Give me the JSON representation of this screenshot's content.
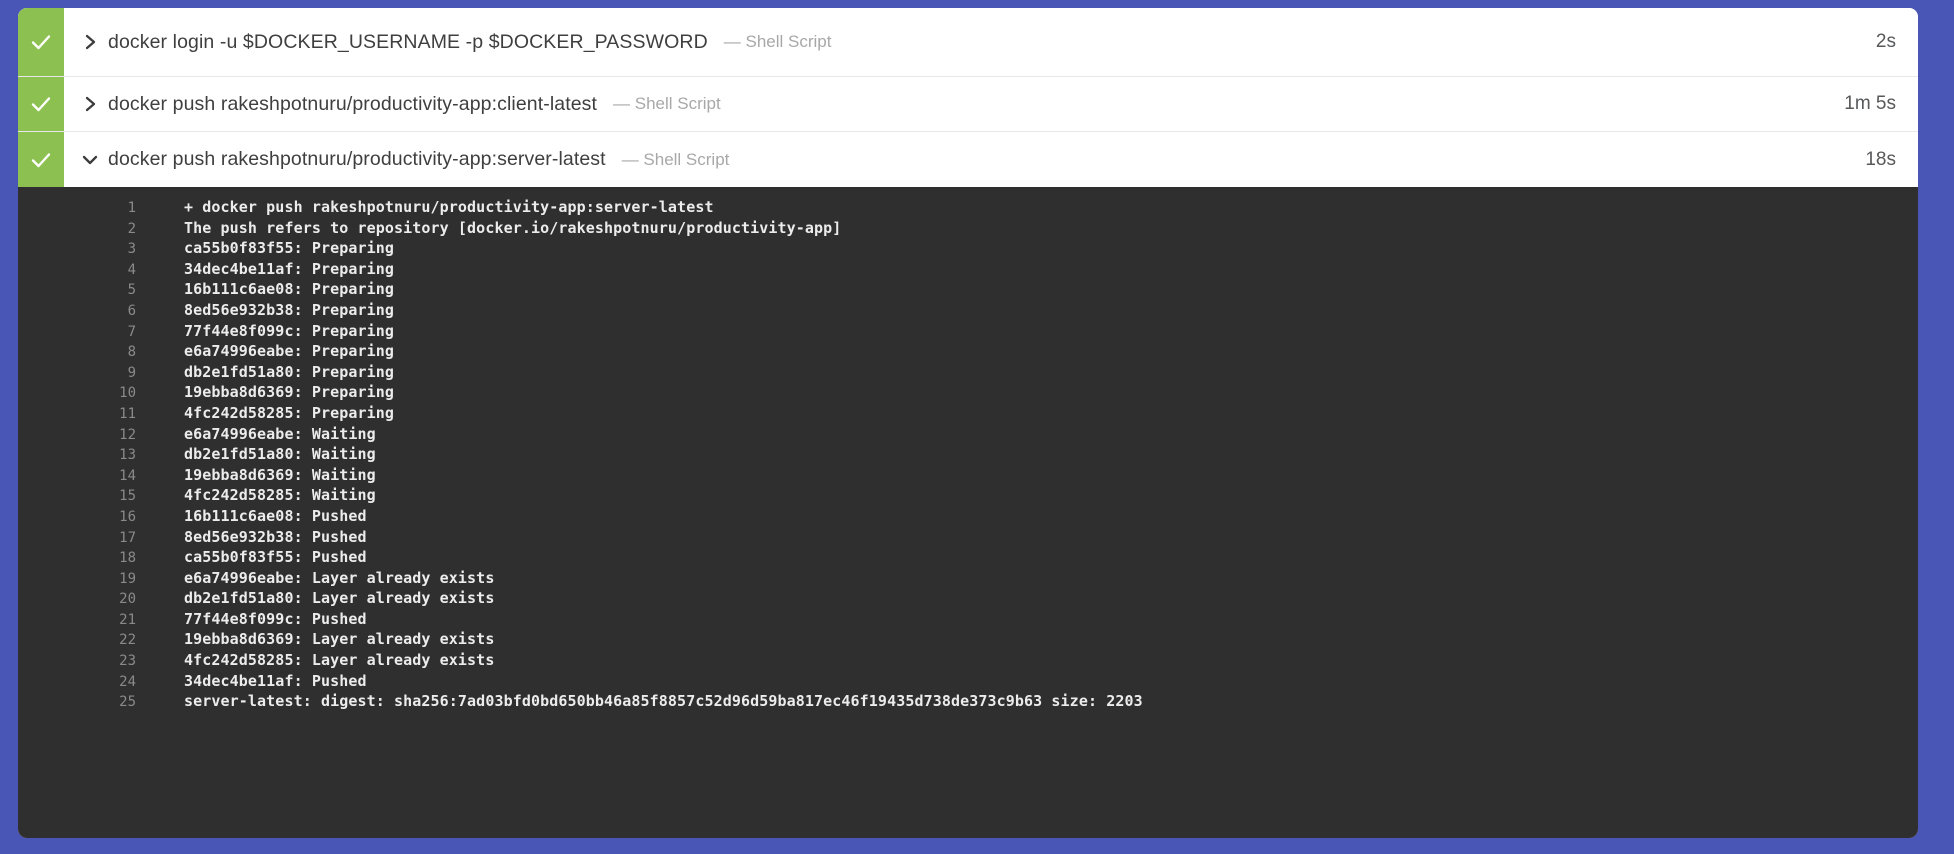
{
  "theme": {
    "page_background": "#4a56b5",
    "card_background": "#ffffff",
    "status_strip": "#8cc152",
    "console_background": "#2f2f2f",
    "console_text": "#ececec",
    "line_number": "#8a8a8a"
  },
  "steps": [
    {
      "status_icon": "check-icon",
      "chevron_icon": "chevron-right-icon",
      "expanded": false,
      "title": "docker login -u $DOCKER_USERNAME -p $DOCKER_PASSWORD",
      "kind": "— Shell Script",
      "duration": "2s"
    },
    {
      "status_icon": "check-icon",
      "chevron_icon": "chevron-right-icon",
      "expanded": false,
      "title": "docker push rakeshpotnuru/productivity-app:client-latest",
      "kind": "— Shell Script",
      "duration": "1m 5s"
    },
    {
      "status_icon": "check-icon",
      "chevron_icon": "chevron-down-icon",
      "expanded": true,
      "title": "docker push rakeshpotnuru/productivity-app:server-latest",
      "kind": "— Shell Script",
      "duration": "18s"
    }
  ],
  "console": {
    "lines": [
      {
        "n": "1",
        "text": "+ docker push rakeshpotnuru/productivity-app:server-latest"
      },
      {
        "n": "2",
        "text": "The push refers to repository [docker.io/rakeshpotnuru/productivity-app]"
      },
      {
        "n": "3",
        "text": "ca55b0f83f55: Preparing"
      },
      {
        "n": "4",
        "text": "34dec4be11af: Preparing"
      },
      {
        "n": "5",
        "text": "16b111c6ae08: Preparing"
      },
      {
        "n": "6",
        "text": "8ed56e932b38: Preparing"
      },
      {
        "n": "7",
        "text": "77f44e8f099c: Preparing"
      },
      {
        "n": "8",
        "text": "e6a74996eabe: Preparing"
      },
      {
        "n": "9",
        "text": "db2e1fd51a80: Preparing"
      },
      {
        "n": "10",
        "text": "19ebba8d6369: Preparing"
      },
      {
        "n": "11",
        "text": "4fc242d58285: Preparing"
      },
      {
        "n": "12",
        "text": "e6a74996eabe: Waiting"
      },
      {
        "n": "13",
        "text": "db2e1fd51a80: Waiting"
      },
      {
        "n": "14",
        "text": "19ebba8d6369: Waiting"
      },
      {
        "n": "15",
        "text": "4fc242d58285: Waiting"
      },
      {
        "n": "16",
        "text": "16b111c6ae08: Pushed"
      },
      {
        "n": "17",
        "text": "8ed56e932b38: Pushed"
      },
      {
        "n": "18",
        "text": "ca55b0f83f55: Pushed"
      },
      {
        "n": "19",
        "text": "e6a74996eabe: Layer already exists"
      },
      {
        "n": "20",
        "text": "db2e1fd51a80: Layer already exists"
      },
      {
        "n": "21",
        "text": "77f44e8f099c: Pushed"
      },
      {
        "n": "22",
        "text": "19ebba8d6369: Layer already exists"
      },
      {
        "n": "23",
        "text": "4fc242d58285: Layer already exists"
      },
      {
        "n": "24",
        "text": "34dec4be11af: Pushed"
      },
      {
        "n": "25",
        "text": "server-latest: digest: sha256:7ad03bfd0bd650bb46a85f8857c52d96d59ba817ec46f19435d738de373c9b63 size: 2203"
      }
    ]
  }
}
